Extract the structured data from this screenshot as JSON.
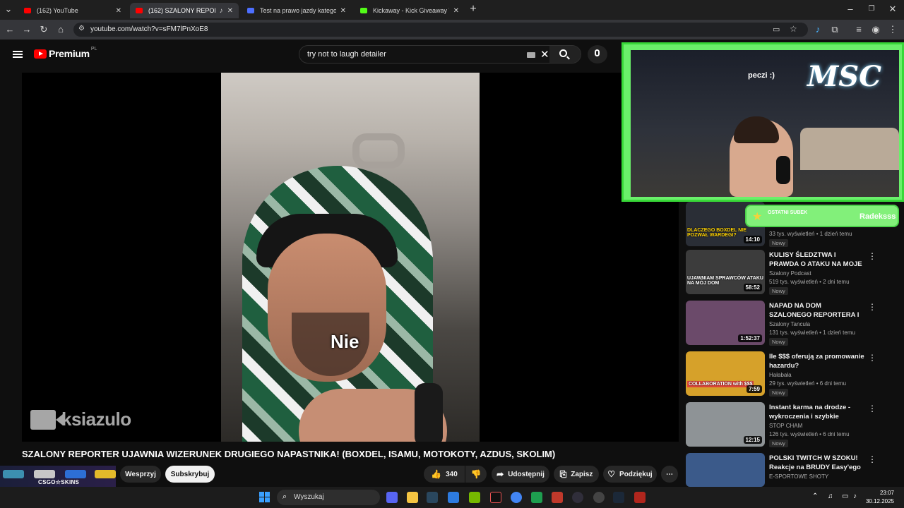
{
  "browser": {
    "tabs": [
      {
        "label": "(162) YouTube",
        "active": false,
        "favicon_color": "#ff0000"
      },
      {
        "label": "(162) SZALONY REPORTER",
        "active": true,
        "favicon_color": "#ff0000"
      },
      {
        "label": "Test na prawo jazdy kategorii B",
        "active": false,
        "favicon_color": "#4d6fff"
      },
      {
        "label": "Kickaway - Kick Giveaway Tool",
        "active": false,
        "favicon_color": "#53fc18"
      }
    ],
    "new_tab": "+",
    "url": "youtube.com/watch?v=sFM7lPnXoE8"
  },
  "youtube": {
    "logo_text": "Premium",
    "country_code": "PL",
    "search_value": "try not to laugh detailer",
    "video": {
      "subtitle": "Nie",
      "watermark": "ksiazulo",
      "title": "SZALONY REPORTER UJAWNIA WIZERUNEK DRUGIEGO NAPASTNIKA! (BOXDEL, ISAMU, MOTOKOTY, AZDUS, SKOLIM)",
      "support_label": "Wesprzyj",
      "subscribe_label": "Subskrybuj",
      "likes": "340",
      "share_label": "Udostępnij",
      "save_label": "Zapisz",
      "thanks_label": "Podziękuj",
      "more_label": "⋯"
    },
    "recommendations": [
      {
        "thumb_text": "DLACZEGO BOXDEL NIE POZWAŁ WARDEGI?",
        "duration": "14:10",
        "title": "",
        "channel": "",
        "meta": "33 tys. wyświetleń • 1 dzień temu",
        "badge": "Nowy",
        "thumb_color": "#2a2e36"
      },
      {
        "thumb_text": "UJAWNIAM SPRAWCÓW ATAKU NA MÓJ DOM",
        "duration": "58:52",
        "title": "KULISY ŚLEDZTWA I PRAWDA O ATAKU NA MOJE ...",
        "channel": "Szalony Podcast",
        "meta": "519 tys. wyświetleń • 2 dni temu",
        "badge": "Nowy",
        "thumb_color": "#3c3c3c"
      },
      {
        "thumb_text": "",
        "duration": "1:52:37",
        "title": "NAPAD NA DOM SZALONEGO REPORTERA I KOMENTARZ ...",
        "channel": "Szalony Tancula",
        "meta": "131 tys. wyświetleń • 1 dzień temu",
        "badge": "Nowy",
        "thumb_color": "#6b4a6a"
      },
      {
        "thumb_text": "COLLABORATION with $$$",
        "duration": "7:59",
        "title": "Ile $$$ oferują za promowanie hazardu?",
        "channel": "Hałabała",
        "meta": "29 tys. wyświetleń • 6 dni temu",
        "badge": "Nowy",
        "thumb_color": "#d6a12a"
      },
      {
        "thumb_text": "",
        "duration": "12:15",
        "title": "Instant karma na drodze - wykroczenia i szybkie spotkan...",
        "channel": "STOP CHAM",
        "meta": "126 tys. wyświetleń • 6 dni temu",
        "badge": "Nowy",
        "thumb_color": "#8e9396"
      },
      {
        "thumb_text": "",
        "duration": "",
        "title": "POLSKI TWITCH W SZOKU! Reakcje na BRUDY Easy'ego",
        "channel": "E-SPORTOWE SHOTY",
        "meta": "",
        "badge": "",
        "thumb_color": "#3b5a8a"
      }
    ]
  },
  "stream_overlay": {
    "logo": "MSC",
    "caption": "peczi :)",
    "sub_label": "OSTATNI SUBEK",
    "sub_name": "Radeksss",
    "csgo_brand": "CSGO☆SKINS"
  },
  "taskbar": {
    "search_placeholder": "Wyszukaj",
    "time": "23:07",
    "date": "30.12.2025"
  }
}
